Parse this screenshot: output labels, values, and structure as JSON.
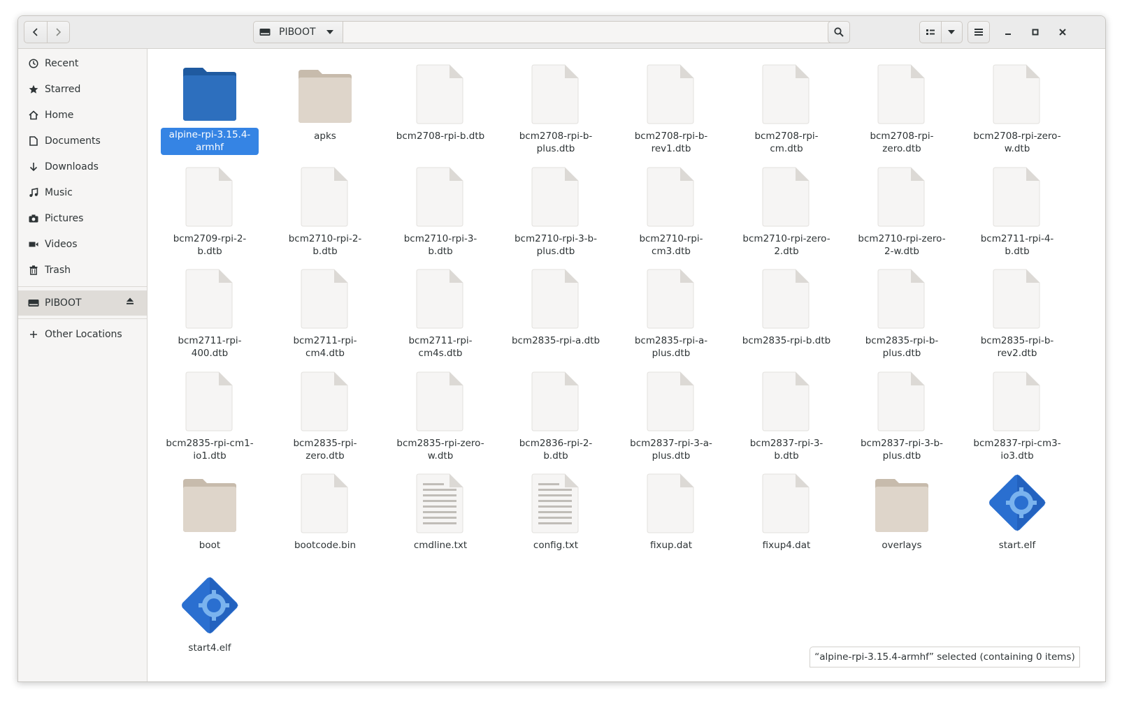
{
  "header": {
    "back_icon": "chevron-left-icon",
    "forward_icon": "chevron-right-icon",
    "location": "PIBOOT",
    "search_icon": "search-icon",
    "view_icon": "list-view-icon",
    "menu_icon": "hamburger-icon",
    "minimize_icon": "minimize-icon",
    "maximize_icon": "maximize-icon",
    "close_icon": "close-icon"
  },
  "sidebar": {
    "items": [
      {
        "label": "Recent",
        "icon": "clock-icon"
      },
      {
        "label": "Starred",
        "icon": "star-icon"
      },
      {
        "label": "Home",
        "icon": "home-icon"
      },
      {
        "label": "Documents",
        "icon": "document-icon"
      },
      {
        "label": "Downloads",
        "icon": "download-icon"
      },
      {
        "label": "Music",
        "icon": "music-icon"
      },
      {
        "label": "Pictures",
        "icon": "camera-icon"
      },
      {
        "label": "Videos",
        "icon": "video-icon"
      },
      {
        "label": "Trash",
        "icon": "trash-icon"
      }
    ],
    "drive": {
      "label": "PIBOOT",
      "icon": "drive-icon",
      "eject_icon": "eject-icon"
    },
    "other": {
      "label": "Other Locations",
      "icon": "plus-icon"
    }
  },
  "files": [
    {
      "name": "alpine-rpi-3.15.4-armhf",
      "type": "folder-selected"
    },
    {
      "name": "apks",
      "type": "folder"
    },
    {
      "name": "bcm2708-rpi-b.dtb",
      "type": "file"
    },
    {
      "name": "bcm2708-rpi-b-plus.dtb",
      "type": "file"
    },
    {
      "name": "bcm2708-rpi-b-rev1.dtb",
      "type": "file"
    },
    {
      "name": "bcm2708-rpi-cm.dtb",
      "type": "file"
    },
    {
      "name": "bcm2708-rpi-zero.dtb",
      "type": "file"
    },
    {
      "name": "bcm2708-rpi-zero-w.dtb",
      "type": "file"
    },
    {
      "name": "bcm2709-rpi-2-b.dtb",
      "type": "file"
    },
    {
      "name": "bcm2710-rpi-2-b.dtb",
      "type": "file"
    },
    {
      "name": "bcm2710-rpi-3-b.dtb",
      "type": "file"
    },
    {
      "name": "bcm2710-rpi-3-b-plus.dtb",
      "type": "file"
    },
    {
      "name": "bcm2710-rpi-cm3.dtb",
      "type": "file"
    },
    {
      "name": "bcm2710-rpi-zero-2.dtb",
      "type": "file"
    },
    {
      "name": "bcm2710-rpi-zero-2-w.dtb",
      "type": "file"
    },
    {
      "name": "bcm2711-rpi-4-b.dtb",
      "type": "file"
    },
    {
      "name": "bcm2711-rpi-400.dtb",
      "type": "file"
    },
    {
      "name": "bcm2711-rpi-cm4.dtb",
      "type": "file"
    },
    {
      "name": "bcm2711-rpi-cm4s.dtb",
      "type": "file"
    },
    {
      "name": "bcm2835-rpi-a.dtb",
      "type": "file"
    },
    {
      "name": "bcm2835-rpi-a-plus.dtb",
      "type": "file"
    },
    {
      "name": "bcm2835-rpi-b.dtb",
      "type": "file"
    },
    {
      "name": "bcm2835-rpi-b-plus.dtb",
      "type": "file"
    },
    {
      "name": "bcm2835-rpi-b-rev2.dtb",
      "type": "file"
    },
    {
      "name": "bcm2835-rpi-cm1-io1.dtb",
      "type": "file"
    },
    {
      "name": "bcm2835-rpi-zero.dtb",
      "type": "file"
    },
    {
      "name": "bcm2835-rpi-zero-w.dtb",
      "type": "file"
    },
    {
      "name": "bcm2836-rpi-2-b.dtb",
      "type": "file"
    },
    {
      "name": "bcm2837-rpi-3-a-plus.dtb",
      "type": "file"
    },
    {
      "name": "bcm2837-rpi-3-b.dtb",
      "type": "file"
    },
    {
      "name": "bcm2837-rpi-3-b-plus.dtb",
      "type": "file"
    },
    {
      "name": "bcm2837-rpi-cm3-io3.dtb",
      "type": "file"
    },
    {
      "name": "boot",
      "type": "folder"
    },
    {
      "name": "bootcode.bin",
      "type": "file"
    },
    {
      "name": "cmdline.txt",
      "type": "text"
    },
    {
      "name": "config.txt",
      "type": "text"
    },
    {
      "name": "fixup.dat",
      "type": "file"
    },
    {
      "name": "fixup4.dat",
      "type": "file"
    },
    {
      "name": "overlays",
      "type": "folder"
    },
    {
      "name": "start.elf",
      "type": "executable"
    },
    {
      "name": "start4.elf",
      "type": "executable"
    }
  ],
  "status": "“alpine-rpi-3.15.4-armhf” selected  (containing 0 items)",
  "colors": {
    "accent": "#3584e4",
    "folder": "#d8cfc4",
    "folder_selected": "#2a6ab8"
  }
}
